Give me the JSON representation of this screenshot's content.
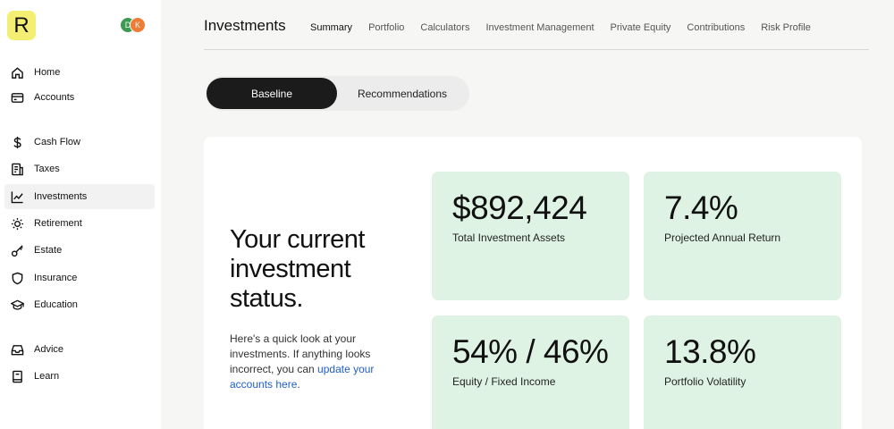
{
  "app": {
    "logo_letter": "R",
    "avatars": [
      "D",
      "K"
    ],
    "colors": {
      "accent_yellow": "#f4ef72",
      "card_green": "#dff3e4",
      "link_blue": "#1f5fc9",
      "dark_button": "#1b1b1b"
    }
  },
  "sidebar": {
    "items": [
      {
        "label": "Home",
        "icon": "home-icon"
      },
      {
        "label": "Accounts",
        "icon": "credit-card-icon"
      },
      {
        "label": "Cash Flow",
        "icon": "dollar-icon"
      },
      {
        "label": "Taxes",
        "icon": "tax-document-icon"
      },
      {
        "label": "Investments",
        "icon": "line-chart-icon",
        "active": true
      },
      {
        "label": "Retirement",
        "icon": "sun-icon"
      },
      {
        "label": "Estate",
        "icon": "key-icon"
      },
      {
        "label": "Insurance",
        "icon": "shield-icon"
      },
      {
        "label": "Education",
        "icon": "graduation-cap-icon"
      },
      {
        "label": "Advice",
        "icon": "inbox-icon"
      },
      {
        "label": "Learn",
        "icon": "book-icon"
      }
    ]
  },
  "header": {
    "title": "Investments",
    "tabs": [
      {
        "label": "Summary",
        "active": true
      },
      {
        "label": "Portfolio"
      },
      {
        "label": "Calculators"
      },
      {
        "label": "Investment Management"
      },
      {
        "label": "Private Equity"
      },
      {
        "label": "Contributions"
      },
      {
        "label": "Risk Profile"
      }
    ]
  },
  "toggle": {
    "baseline_label": "Baseline",
    "recommendations_label": "Recommendations"
  },
  "summary": {
    "headline": "Your current investment status.",
    "description_prefix": "Here's a quick look at your investments. If anything looks incorrect, you can ",
    "description_link": "update your accounts here",
    "description_suffix": "."
  },
  "metrics": [
    {
      "value": "$892,424",
      "label": "Total Investment Assets"
    },
    {
      "value": "7.4%",
      "label": "Projected Annual Return"
    },
    {
      "value": "54% / 46%",
      "label": "Equity / Fixed Income"
    },
    {
      "value": "13.8%",
      "label": "Portfolio Volatility"
    }
  ]
}
